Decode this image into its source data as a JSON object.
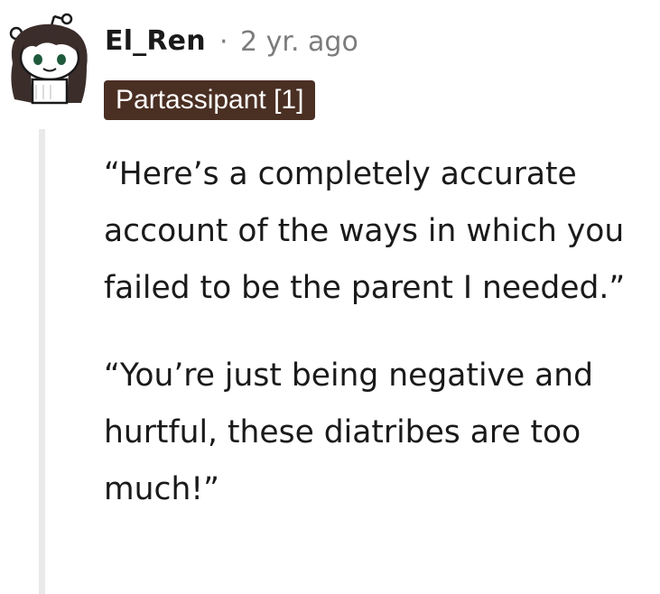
{
  "comment": {
    "username": "El_Ren",
    "separator": "·",
    "timestamp": "2 yr. ago",
    "flair": "Partassipant [1]",
    "paragraphs": [
      "“Here’s a completely accurate account of the ways in which you failed to be the parent I needed.”",
      "“You’re just being negative and hurtful, these diatribes are too much!”"
    ]
  },
  "colors": {
    "flair_background": "#4a2f23",
    "flair_text": "#ffffff",
    "meta_text": "#7c7c7c",
    "thread_line": "#e9e9e9",
    "body_text": "#1a1a1b"
  },
  "icons": {
    "avatar": "snoo-avatar-icon"
  }
}
